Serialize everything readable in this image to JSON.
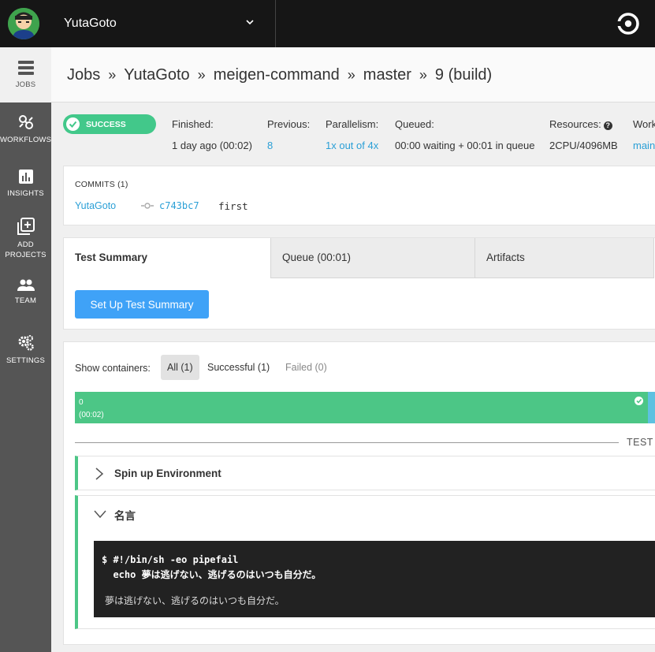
{
  "topbar": {
    "org_name": "YutaGoto"
  },
  "sidebar": {
    "items": [
      {
        "label": "JOBS",
        "icon": "jobs-icon"
      },
      {
        "label": "WORKFLOWS",
        "icon": "workflows-icon"
      },
      {
        "label": "INSIGHTS",
        "icon": "insights-icon"
      },
      {
        "label_line1": "ADD",
        "label_line2": "PROJECTS",
        "icon": "add-projects-icon"
      },
      {
        "label": "TEAM",
        "icon": "team-icon"
      },
      {
        "label": "SETTINGS",
        "icon": "settings-icon"
      }
    ]
  },
  "breadcrumb": {
    "items": [
      "Jobs",
      "YutaGoto",
      "meigen-command",
      "master",
      "9 (build)"
    ],
    "separator": "»"
  },
  "build": {
    "status": "SUCCESS",
    "status_color": "#42c88a",
    "finished_label": "Finished:",
    "finished_value": "1 day ago (00:02)",
    "previous_label": "Previous:",
    "previous_value": "8",
    "parallelism_label": "Parallelism:",
    "parallelism_value": "1x out of 4x",
    "queued_label": "Queued:",
    "queued_value": "00:00 waiting + 00:01 in queue",
    "resources_label": "Resources:",
    "resources_help": "?",
    "resources_value": "2CPU/4096MB",
    "workflow_label": "Work",
    "workflow_value": "main"
  },
  "commits": {
    "title": "COMMITS (1)",
    "items": [
      {
        "author": "YutaGoto",
        "hash": "c743bc7",
        "message": "first"
      }
    ]
  },
  "tabs": {
    "items": [
      "Test Summary",
      "Queue (00:01)",
      "Artifacts"
    ],
    "setup_button": "Set Up Test Summary"
  },
  "containers": {
    "show_label": "Show containers:",
    "filters": [
      "All (1)",
      "Successful (1)",
      "Failed (0)"
    ],
    "bar": {
      "index": "0",
      "duration": "(00:02)",
      "color": "#4cc686"
    },
    "section_label": "TEST"
  },
  "steps": [
    {
      "title": "Spin up Environment",
      "expanded": false
    },
    {
      "title": "名言",
      "expanded": true,
      "command_line1": "$ #!/bin/sh -eo pipefail",
      "command_line2": "  echo 夢は逃げない、逃げるのはいつも自分だ。",
      "output": "夢は逃げない、逃げるのはいつも自分だ。"
    }
  ]
}
